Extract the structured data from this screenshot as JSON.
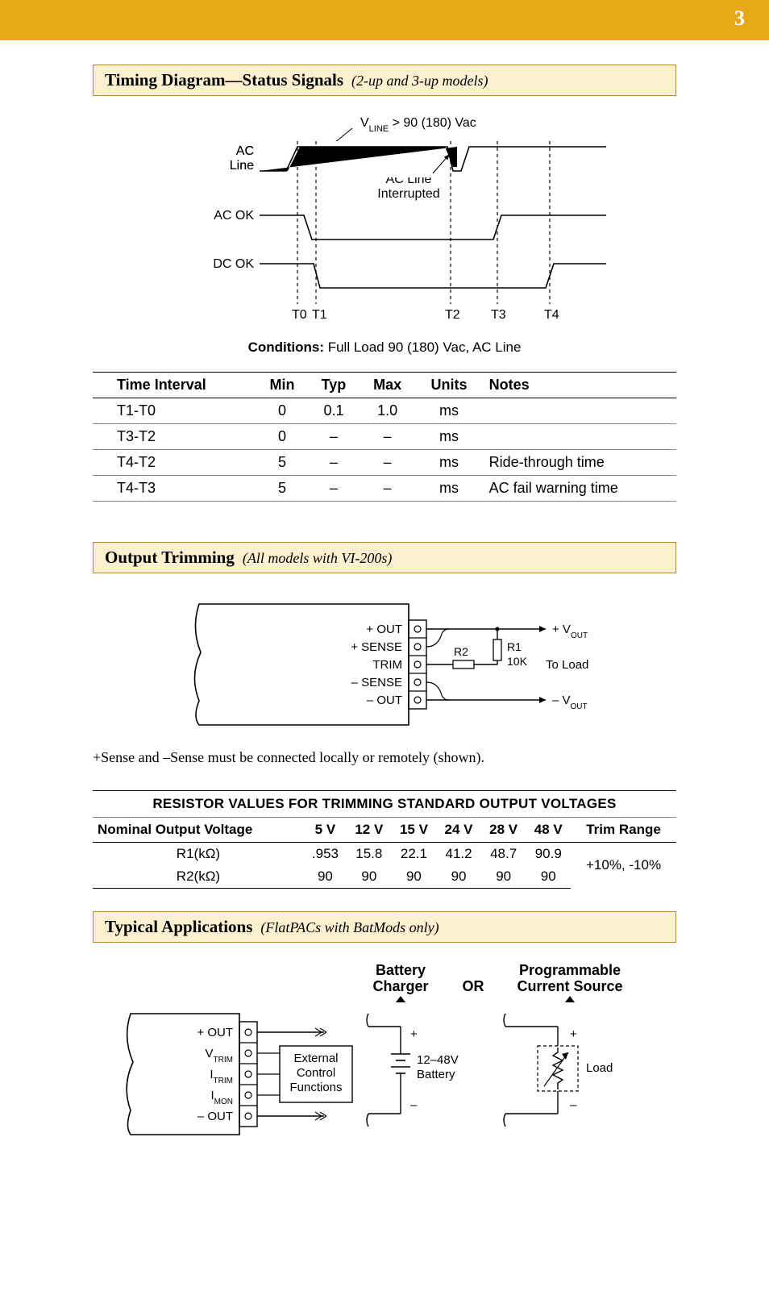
{
  "page_number": "3",
  "section1": {
    "title": "Timing Diagram—Status Signals",
    "subtitle": "(2-up and 3-up models)",
    "diagram": {
      "vline_label": "VLINE > 90 (180) Vac",
      "ac_line": "AC Line",
      "ac_ok": "AC OK",
      "dc_ok": "DC OK",
      "ac_interrupted": "AC Line Interrupted",
      "t0": "T0",
      "t1": "T1",
      "t2": "T2",
      "t3": "T3",
      "t4": "T4"
    },
    "conditions_label": "Conditions:",
    "conditions_text": " Full Load 90 (180) Vac, AC Line",
    "table": {
      "headers": [
        "Time Interval",
        "Min",
        "Typ",
        "Max",
        "Units",
        "Notes"
      ],
      "rows": [
        [
          "T1-T0",
          "0",
          "0.1",
          "1.0",
          "ms",
          ""
        ],
        [
          "T3-T2",
          "0",
          "–",
          "–",
          "ms",
          ""
        ],
        [
          "T4-T2",
          "5",
          "–",
          "–",
          "ms",
          "Ride-through time"
        ],
        [
          "T4-T3",
          "5",
          "–",
          "–",
          "ms",
          "AC fail warning time"
        ]
      ]
    }
  },
  "section2": {
    "title": "Output Trimming",
    "subtitle": "(All models with VI-200s)",
    "diagram": {
      "out_p": "+ OUT",
      "sense_p": "+ SENSE",
      "trim": "TRIM",
      "sense_n": "– SENSE",
      "out_n": "– OUT",
      "r1": "R1",
      "r1v": "10K",
      "r2": "R2",
      "vout_p": "+ VOUT",
      "vout_n": "– VOUT",
      "to_load": "To Load"
    },
    "note": "+Sense and –Sense must be connected locally or remotely (shown).",
    "trim_table": {
      "title": "RESISTOR VALUES FOR TRIMMING STANDARD OUTPUT VOLTAGES",
      "col0": "Nominal Output Voltage",
      "cols": [
        "5 V",
        "12 V",
        "15 V",
        "24 V",
        "28 V",
        "48 V"
      ],
      "col_range": "Trim Range",
      "r1_label": "R1(kΩ)",
      "r1_vals": [
        ".953",
        "15.8",
        "22.1",
        "41.2",
        "48.7",
        "90.9"
      ],
      "r2_label": "R2(kΩ)",
      "r2_vals": [
        "90",
        "90",
        "90",
        "90",
        "90",
        "90"
      ],
      "range": "+10%, -10%"
    }
  },
  "section3": {
    "title": "Typical Applications",
    "subtitle": "(FlatPACs with BatMods only)",
    "diagram": {
      "battery_charger": "Battery Charger",
      "or": "OR",
      "prog_source": "Programmable Current Source",
      "out_p": "+ OUT",
      "vtrim": "VTRIM",
      "itrim": "ITRIM",
      "imon": "IMON",
      "out_n": "– OUT",
      "ext_ctrl1": "External",
      "ext_ctrl2": "Control",
      "ext_ctrl3": "Functions",
      "batt_v": "12–48V",
      "batt": "Battery",
      "plus": "+",
      "minus": "–",
      "load": "Load"
    }
  }
}
